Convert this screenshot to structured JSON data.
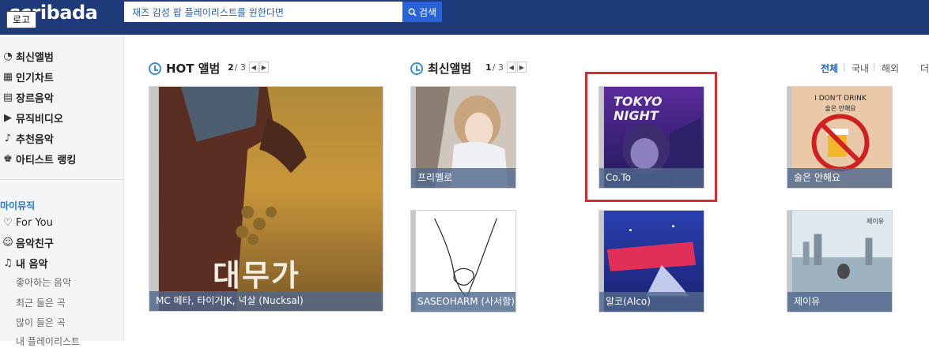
{
  "header": {
    "logo_text": "scribada",
    "logo_badge": "로고",
    "search_value": "재즈 감성 팝 플레이리스트를 원한다면",
    "search_button": "검색"
  },
  "sidebar": {
    "items": [
      {
        "label": "최신앨범",
        "icon": "new-album-icon"
      },
      {
        "label": "인기차트",
        "icon": "chart-icon"
      },
      {
        "label": "장르음악",
        "icon": "genre-icon"
      },
      {
        "label": "뮤직비디오",
        "icon": "video-icon"
      },
      {
        "label": "추천음악",
        "icon": "music-note-icon"
      },
      {
        "label": "아티스트 랭킹",
        "icon": "artist-icon"
      }
    ],
    "my_music_heading": "마이뮤직",
    "my_items": [
      {
        "label": "For You",
        "icon": "heart-icon"
      },
      {
        "label": "음악친구",
        "icon": "friends-icon"
      },
      {
        "label": "내 음악",
        "icon": "my-music-icon"
      }
    ],
    "sub_items": [
      "좋아하는 음악",
      "최근 들은 곡",
      "많이 들은 곡",
      "내 플레이리스트"
    ]
  },
  "hot": {
    "title": "HOT 앨범",
    "page_current": "2",
    "page_total": "/ 3",
    "album_caption": "MC 메타, 타이거JK, 넉살 (Nucksal)",
    "album_cover_text": "대무가"
  },
  "new": {
    "title": "최신앨범",
    "page_current": "1",
    "page_total": "/ 3",
    "filters": [
      "전체",
      "국내",
      "해외",
      "더"
    ],
    "albums": [
      {
        "caption": "프리멜로",
        "cover_text": ""
      },
      {
        "caption": "Co.To",
        "cover_text": "TOKYO NIGHT"
      },
      {
        "caption": "술은 안해요",
        "cover_text": "I DON'T DRINK",
        "cover_sub": "술은 안해요"
      },
      {
        "caption": "SASEOHARM (사서함)",
        "cover_text": ""
      },
      {
        "caption": "알코(Alco)",
        "cover_text": ""
      },
      {
        "caption": "제이유",
        "cover_text": "제이유"
      }
    ]
  },
  "colors": {
    "header_bg": "#1e3a78",
    "accent": "#2a62d8",
    "highlight": "#d62c2c"
  }
}
